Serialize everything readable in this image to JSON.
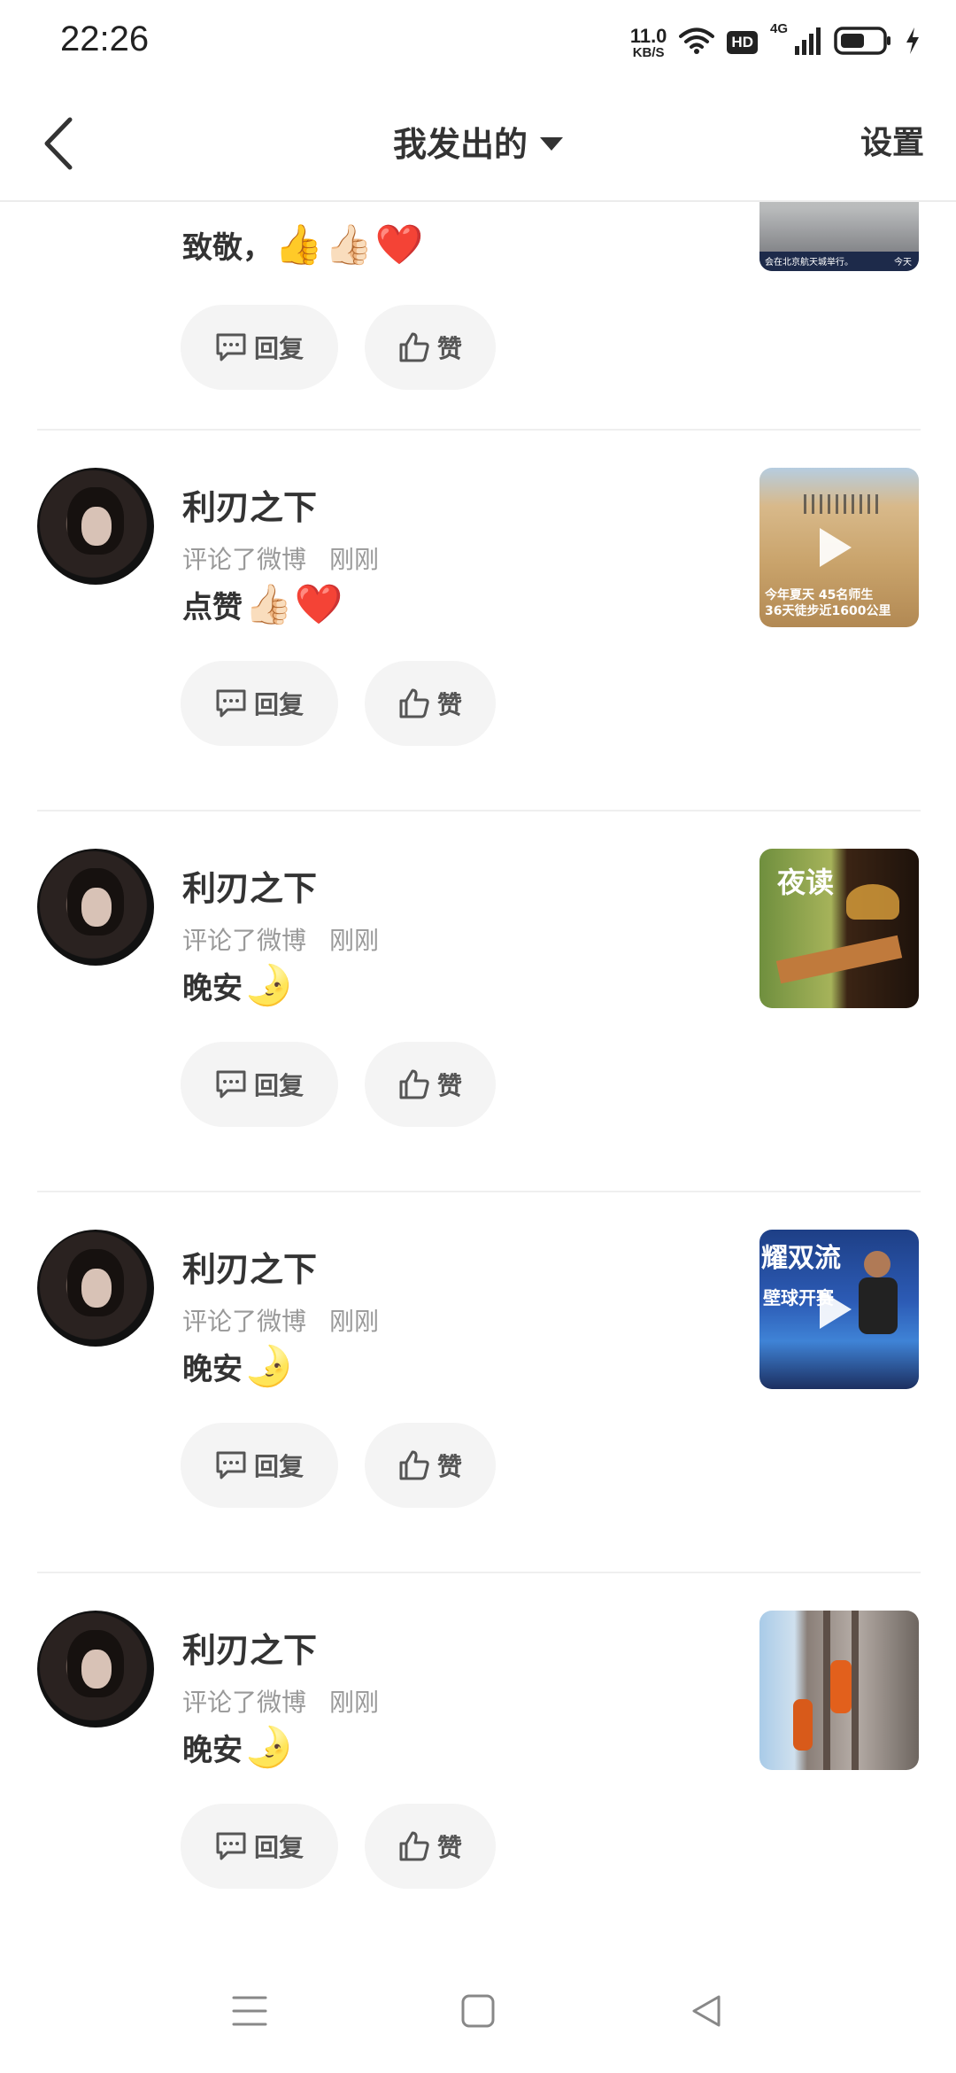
{
  "status_bar": {
    "time": "22:26",
    "net_speed_value": "11.0",
    "net_speed_unit": "KB/S",
    "hd_label": "HD",
    "net_type": "4G",
    "icons": [
      "wifi-icon",
      "signal-icon",
      "battery-icon",
      "charging-icon"
    ]
  },
  "header": {
    "title": "我发出的",
    "settings_label": "设置",
    "icons": [
      "back-icon",
      "caret-down-icon"
    ]
  },
  "actions": {
    "reply_label": "回复",
    "like_label": "赞"
  },
  "partial_card": {
    "comment": "致敬，",
    "emojis": [
      "👍",
      "👍🏻",
      "❤️"
    ],
    "thumb_caption_left": "会在北京航天城举行。",
    "thumb_caption_right": "今天"
  },
  "cards": [
    {
      "user": "利刃之下",
      "action": "评论了微博",
      "time": "刚刚",
      "comment": "点赞",
      "emojis": [
        "👍🏻",
        "❤️"
      ],
      "thumbnail": {
        "kind": "desert-video",
        "has_play": true,
        "caption_1": "今年夏天 45名师生",
        "caption_2": "36天徒步近1600公里"
      }
    },
    {
      "user": "利刃之下",
      "action": "评论了微博",
      "time": "刚刚",
      "comment": "晚安",
      "emojis": [
        "🌛"
      ],
      "thumbnail": {
        "kind": "night-reading",
        "has_play": false,
        "caption_1": "夜读",
        "caption_2": ""
      }
    },
    {
      "user": "利刃之下",
      "action": "评论了微博",
      "time": "刚刚",
      "comment": "晚安",
      "emojis": [
        "🌛"
      ],
      "thumbnail": {
        "kind": "squash-video",
        "has_play": true,
        "caption_1": "耀双流",
        "caption_2": "壁球开赛"
      }
    },
    {
      "user": "利刃之下",
      "action": "评论了微博",
      "time": "刚刚",
      "comment": "晚安",
      "emojis": [
        "🌛"
      ],
      "thumbnail": {
        "kind": "firefighters",
        "has_play": false,
        "caption_1": "",
        "caption_2": ""
      }
    }
  ],
  "nav_bar": {
    "icons": [
      "menu-icon",
      "home-icon",
      "back-triangle-icon"
    ]
  }
}
